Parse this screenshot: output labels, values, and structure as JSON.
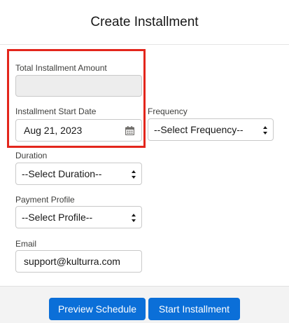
{
  "modal": {
    "title": "Create Installment"
  },
  "form": {
    "total_amount": {
      "label": "Total Installment Amount",
      "value": ""
    },
    "start_date": {
      "label": "Installment Start Date",
      "value": "Aug 21, 2023"
    },
    "frequency": {
      "label": "Frequency",
      "selected": "--Select Frequency--"
    },
    "duration": {
      "label": "Duration",
      "selected": "--Select Duration--"
    },
    "payment_profile": {
      "label": "Payment Profile",
      "selected": "--Select Profile--"
    },
    "email": {
      "label": "Email",
      "value": "support@kulturra.com"
    }
  },
  "footer": {
    "preview_label": "Preview Schedule",
    "start_label": "Start Installment"
  },
  "colors": {
    "brand_button": "#0b6fd8",
    "highlight": "#e3261c",
    "disabled_field": "#ededed"
  },
  "icons": {
    "date_picker": "calendar-icon",
    "select_toggle": "up-down-arrows-icon"
  }
}
